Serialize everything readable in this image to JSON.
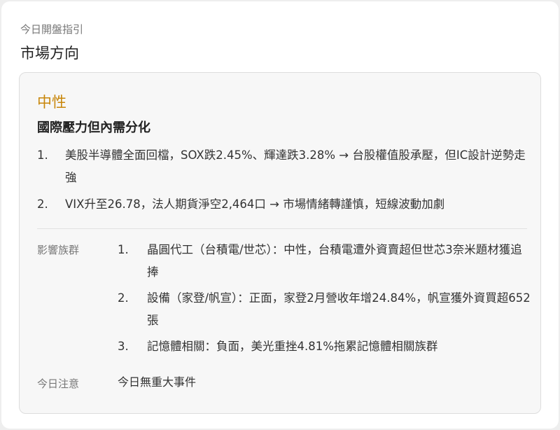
{
  "header": {
    "kicker": "今日開盤指引",
    "title": "市場方向"
  },
  "card": {
    "sentiment": "中性",
    "headline": "國際壓力但內需分化",
    "points": [
      {
        "num": "1.",
        "text": "美股半導體全面回檔，SOX跌2.45%、輝達跌3.28% → 台股權值股承壓，但IC設計逆勢走強"
      },
      {
        "num": "2.",
        "text": "VIX升至26.78，法人期貨淨空2,464口 → 市場情緒轉謹慎，短線波動加劇"
      }
    ],
    "impact": {
      "label": "影響族群",
      "items": [
        {
          "num": "1.",
          "text": "晶圓代工（台積電/世芯）：中性，台積電遭外資賣超但世芯3奈米題材獲追捧"
        },
        {
          "num": "2.",
          "text": "設備（家登/帆宣）：正面，家登2月營收年增24.84%，帆宣獲外資買超652張"
        },
        {
          "num": "3.",
          "text": "記憶體相關：負面，美光重挫4.81%拖累記憶體相關族群"
        }
      ]
    },
    "note": {
      "label": "今日注意",
      "value": "今日無重大事件"
    }
  },
  "colors": {
    "sentiment": "#c8860a",
    "card_bg": "#f7f7f7",
    "border": "#dddddd"
  }
}
